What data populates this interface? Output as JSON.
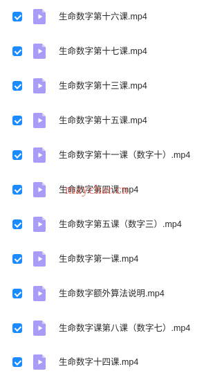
{
  "files": [
    {
      "name": "生命数字第十六课.mp4",
      "checked": true,
      "icon": "video-file-icon"
    },
    {
      "name": "生命数字第十七课.mp4",
      "checked": true,
      "icon": "video-file-icon"
    },
    {
      "name": "生命数字第十三课.mp4",
      "checked": true,
      "icon": "video-file-icon"
    },
    {
      "name": "生命数字第十五课.mp4",
      "checked": true,
      "icon": "video-file-icon"
    },
    {
      "name": "生命数字第十一课（数字十）.mp4",
      "checked": true,
      "icon": "video-file-icon"
    },
    {
      "name": "生命数字第四课.mp4",
      "checked": true,
      "icon": "video-file-icon"
    },
    {
      "name": "生命数字第五课（数字三）.mp4",
      "checked": true,
      "icon": "video-file-icon"
    },
    {
      "name": "生命数字第一课.mp4",
      "checked": true,
      "icon": "video-file-icon"
    },
    {
      "name": "生命数字额外算法说明.mp4",
      "checked": true,
      "icon": "video-file-icon"
    },
    {
      "name": "生命数字课第八课（数字七）.mp4",
      "checked": true,
      "icon": "video-file-icon"
    },
    {
      "name": "生命数字十四课.mp4",
      "checked": true,
      "icon": "video-file-icon"
    }
  ],
  "watermark": "maychar.cn",
  "colors": {
    "checkbox": "#1a8cff",
    "icon_fill": "#a99cf7",
    "icon_fold": "#d4ccfb",
    "text": "#2b2b2b",
    "watermark": "#e1463c"
  }
}
